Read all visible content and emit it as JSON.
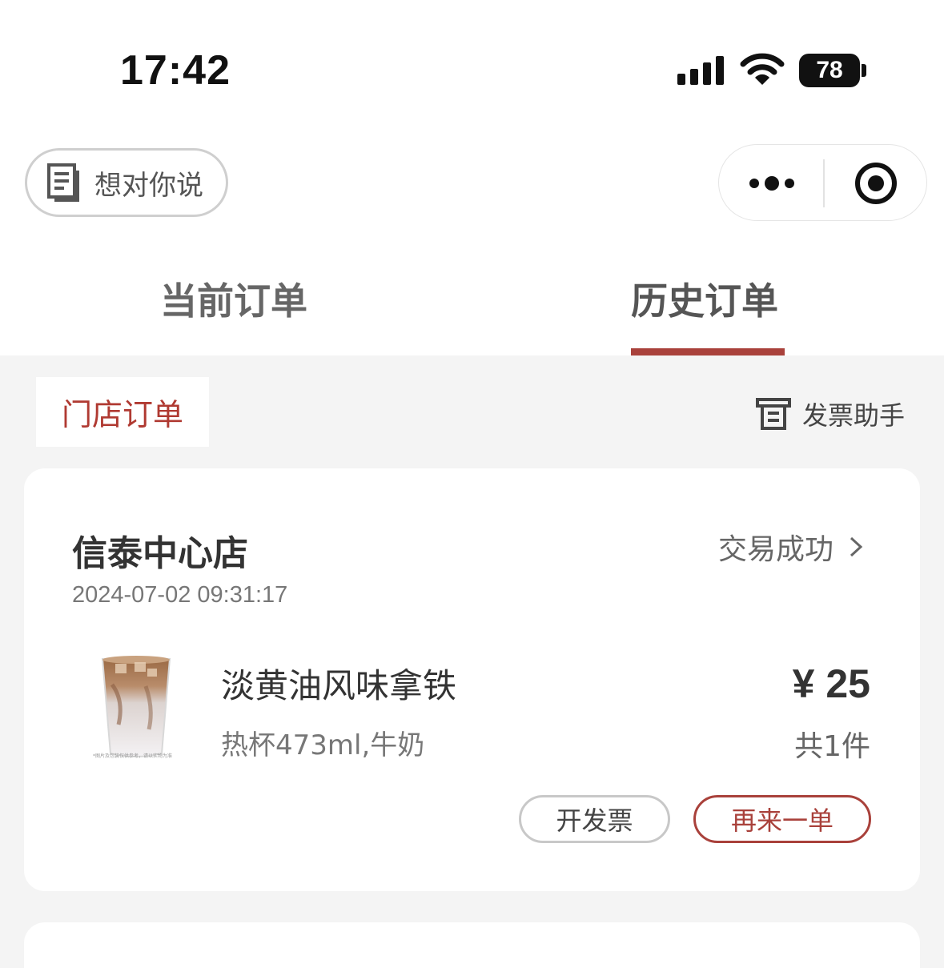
{
  "status_bar": {
    "time": "17:42",
    "battery": "78"
  },
  "header": {
    "feedback_label": "想对你说"
  },
  "tabs": [
    {
      "label": "当前订单",
      "active": false
    },
    {
      "label": "历史订单",
      "active": true
    }
  ],
  "subheader": {
    "store_order_tab": "门店订单",
    "invoice_helper": "发票助手"
  },
  "order": {
    "store_name": "信泰中心店",
    "status": "交易成功",
    "time": "2024-07-02 09:31:17",
    "product": {
      "name": "淡黄油风味拿铁",
      "spec": "热杯473ml,牛奶",
      "image_note": "*图片及包装仅供参考，请以实物为准"
    },
    "price": "¥ 25",
    "count": "共1件",
    "buttons": {
      "invoice": "开发票",
      "reorder": "再来一单"
    }
  },
  "colors": {
    "accent": "#a9413b",
    "background": "#f4f4f4"
  }
}
